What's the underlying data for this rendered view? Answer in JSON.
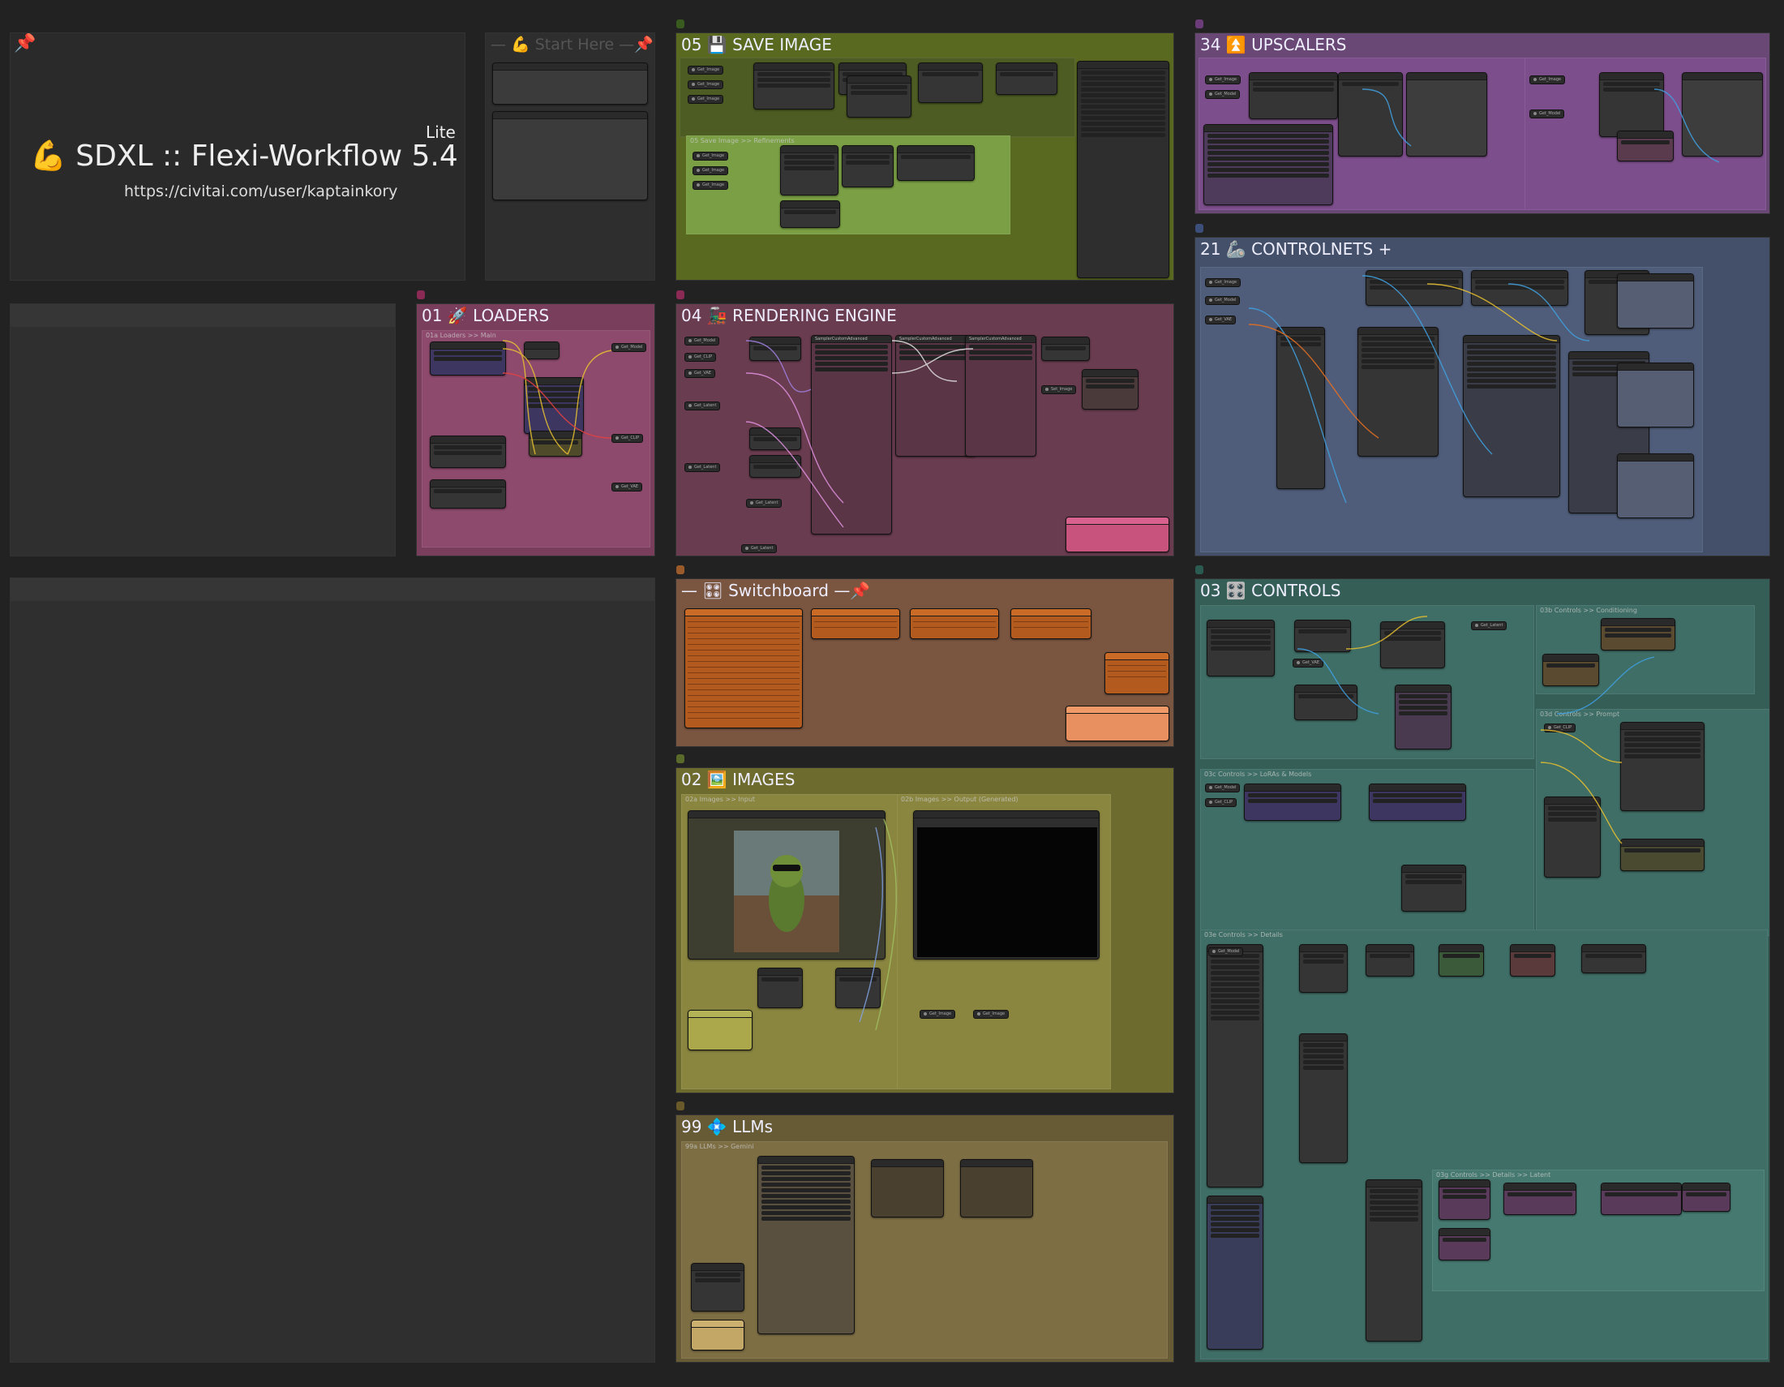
{
  "title_panel": {
    "pin": "📌",
    "title": "💪 SDXL :: Flexi-Workflow 5.4",
    "edition": "Lite",
    "url": "https://civitai.com/user/kaptainkory"
  },
  "start_here": {
    "label": "— 💪 Start Here —📌"
  },
  "groups": {
    "save_image": {
      "num": "05",
      "label": "💾 SAVE IMAGE",
      "sub": "05 Save Image >> Refinements"
    },
    "upscalers": {
      "num": "34",
      "label": "⏫ UPSCALERS"
    },
    "loaders": {
      "num": "01",
      "label": "🚀 LOADERS",
      "sub": "01a Loaders >> Main"
    },
    "rendering": {
      "num": "04",
      "label": "🚂 RENDERING ENGINE"
    },
    "controlnets": {
      "num": "21",
      "label": "🦾 CONTROLNETS +"
    },
    "switchboard": {
      "label": "— 🎛 Switchboard —📌"
    },
    "controls": {
      "num": "03",
      "label": "🎛️ CONTROLS"
    },
    "images": {
      "num": "02",
      "label": "🖼️ IMAGES",
      "sub_a": "02a Images >> Input",
      "sub_b": "02b Images >> Output (Generated)"
    },
    "llms": {
      "num": "99",
      "label": "💠 LLMs",
      "sub": "99a LLMs >> Gemini"
    }
  },
  "controls_subgroups": {
    "conditioning": "03b Controls >> Conditioning",
    "prompt": "03d Controls >> Prompt",
    "loras": "03c Controls >> LoRAs & Models",
    "details": "03e Controls >> Details",
    "latent": "03g Controls >> Details >> Latent"
  },
  "node_labels": {
    "get_image": "Get_Image",
    "get_model": "Get_Model",
    "get_clip": "Get_CLIP",
    "get_vae": "Get_VAE",
    "get_latent": "Get_Latent",
    "sampler": "SamplerCustomAdvanced",
    "set_image": "Set_Image",
    "ksampler": "KSampler"
  },
  "colors": {
    "save": "#59691f",
    "upscalers": "#694876",
    "loaders": "#7a3e5d",
    "rendering": "#693c4f",
    "controlnets": "#445069",
    "switchboard": "#7a5640",
    "controls": "#355e57",
    "images": "#6e6b2e",
    "llms": "#675b36"
  }
}
